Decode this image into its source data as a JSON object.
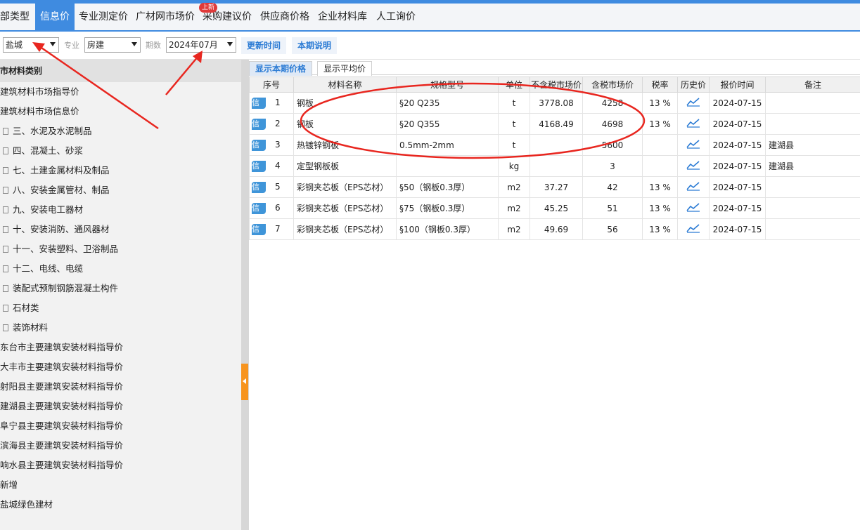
{
  "tabs": [
    {
      "label": "部类型"
    },
    {
      "label": "信息价"
    },
    {
      "label": "专业测定价"
    },
    {
      "label": "广材网市场价"
    },
    {
      "label": "采购建议价",
      "badge": "上新"
    },
    {
      "label": "供应商价格"
    },
    {
      "label": "企业材料库"
    },
    {
      "label": "人工询价"
    }
  ],
  "toolbar": {
    "region": "盐城",
    "specialty_label": "专业",
    "specialty": "房建",
    "period_label": "期数",
    "period": "2024年07月",
    "update_time_button": "更新时间",
    "period_note_button": "本期说明"
  },
  "sidebar": {
    "header": "市材料类别",
    "items": [
      {
        "label": "建筑材料市场指导价",
        "doc": false
      },
      {
        "label": "建筑材料市场信息价",
        "doc": false
      },
      {
        "label": "三、水泥及水泥制品",
        "doc": true
      },
      {
        "label": "四、混凝土、砂浆",
        "doc": true
      },
      {
        "label": "七、土建金属材料及制品",
        "doc": true
      },
      {
        "label": "八、安装金属管材、制品",
        "doc": true
      },
      {
        "label": "九、安装电工器材",
        "doc": true
      },
      {
        "label": "十、安装消防、通风器材",
        "doc": true
      },
      {
        "label": "十一、安装塑料、卫浴制品",
        "doc": true
      },
      {
        "label": "十二、电线、电缆",
        "doc": true
      },
      {
        "label": "装配式预制钢筋混凝土构件",
        "doc": true
      },
      {
        "label": "石材类",
        "doc": true
      },
      {
        "label": "装饰材料",
        "doc": true
      },
      {
        "label": "东台市主要建筑安装材料指导价",
        "doc": false
      },
      {
        "label": "大丰市主要建筑安装材料指导价",
        "doc": false
      },
      {
        "label": "射阳县主要建筑安装材料指导价",
        "doc": false
      },
      {
        "label": "建湖县主要建筑安装材料指导价",
        "doc": false
      },
      {
        "label": "阜宁县主要建筑安装材料指导价",
        "doc": false
      },
      {
        "label": "滨海县主要建筑安装材料指导价",
        "doc": false
      },
      {
        "label": "响水县主要建筑安装材料指导价",
        "doc": false
      },
      {
        "label": "新增",
        "doc": false
      },
      {
        "label": "盐城绿色建材",
        "doc": false
      }
    ]
  },
  "subtabs": [
    "显示本期价格",
    "显示平均价"
  ],
  "table": {
    "headers": [
      "序号",
      "材料名称",
      "规格型号",
      "单位",
      "不含税市场价",
      "含税市场价",
      "税率",
      "历史价",
      "报价时间",
      "备注"
    ],
    "row_tag": "信",
    "rows": [
      {
        "no": "1",
        "name": "钢板",
        "spec": "§20 Q235",
        "unit": "t",
        "ex_tax": "3778.08",
        "inc_tax": "4258",
        "rate": "13 %",
        "date": "2024-07-15",
        "note": ""
      },
      {
        "no": "2",
        "name": "钢板",
        "spec": "§20 Q355",
        "unit": "t",
        "ex_tax": "4168.49",
        "inc_tax": "4698",
        "rate": "13 %",
        "date": "2024-07-15",
        "note": ""
      },
      {
        "no": "3",
        "name": "热镀锌钢板",
        "spec": "0.5mm-2mm",
        "unit": "t",
        "ex_tax": "",
        "inc_tax": "5600",
        "rate": "",
        "date": "2024-07-15",
        "note": "建湖县"
      },
      {
        "no": "4",
        "name": "定型钢板板",
        "spec": "",
        "unit": "kg",
        "ex_tax": "",
        "inc_tax": "3",
        "rate": "",
        "date": "2024-07-15",
        "note": "建湖县"
      },
      {
        "no": "5",
        "name": "彩钢夹芯板（EPS芯材）",
        "spec": "§50（钢板0.3厚）",
        "unit": "m2",
        "ex_tax": "37.27",
        "inc_tax": "42",
        "rate": "13 %",
        "date": "2024-07-15",
        "note": ""
      },
      {
        "no": "6",
        "name": "彩钢夹芯板（EPS芯材）",
        "spec": "§75（钢板0.3厚）",
        "unit": "m2",
        "ex_tax": "45.25",
        "inc_tax": "51",
        "rate": "13 %",
        "date": "2024-07-15",
        "note": ""
      },
      {
        "no": "7",
        "name": "彩钢夹芯板（EPS芯材）",
        "spec": "§100（钢板0.3厚）",
        "unit": "m2",
        "ex_tax": "49.69",
        "inc_tax": "56",
        "rate": "13 %",
        "date": "2024-07-15",
        "note": ""
      }
    ]
  },
  "colors": {
    "accent": "#3f8be0",
    "annotation_red": "#e8261f",
    "collapse_orange": "#f7941e"
  }
}
